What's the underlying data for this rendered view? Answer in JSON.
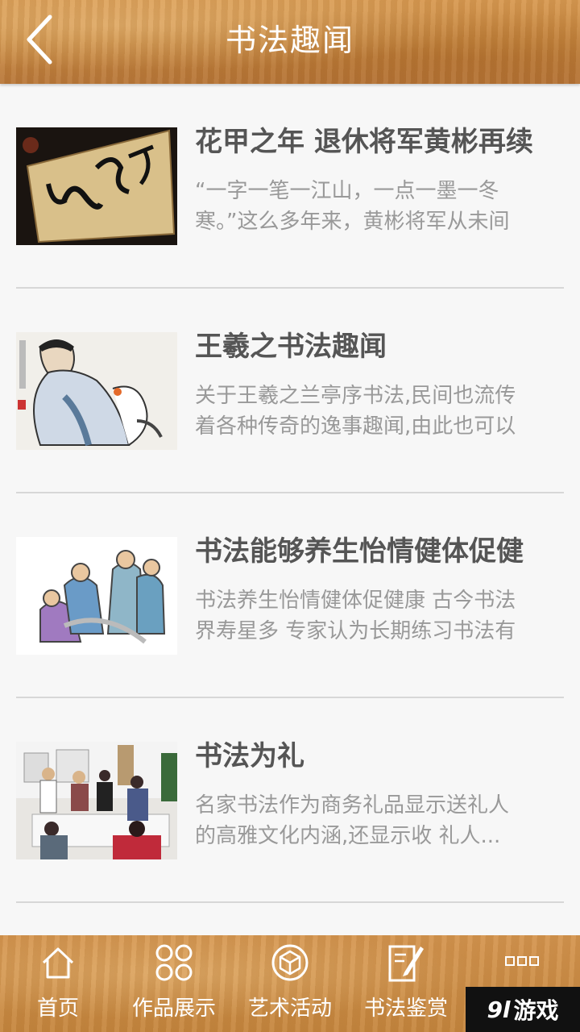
{
  "header": {
    "title": "书法趣闻"
  },
  "articles": [
    {
      "title": "花甲之年 退休将军黄彬再续",
      "summary": "“一字一笔一江山，一点一墨一冬寒。”这么多年来，黄彬将军从未间"
    },
    {
      "title": "王羲之书法趣闻",
      "summary": "关于王羲之兰亭序书法,民间也流传着各种传奇的逸事趣闻,由此也可以"
    },
    {
      "title": "书法能够养生怡情健体促健",
      "summary": "书法养生怡情健体促健康 古今书法界寿星多 专家认为长期练习书法有"
    },
    {
      "title": "书法为礼",
      "summary": "名家书法作为商务礼品显示送礼人的高雅文化内涵,还显示收 礼人...他"
    }
  ],
  "nav": {
    "items": [
      {
        "label": "首页",
        "icon": "home-icon"
      },
      {
        "label": "作品展示",
        "icon": "grid-icon"
      },
      {
        "label": "艺术活动",
        "icon": "box-icon"
      },
      {
        "label": "书法鉴赏",
        "icon": "edit-icon"
      },
      {
        "label": "",
        "icon": "more-icon"
      }
    ]
  },
  "watermark": {
    "brand_num": "9l",
    "brand_text": "游戏"
  }
}
